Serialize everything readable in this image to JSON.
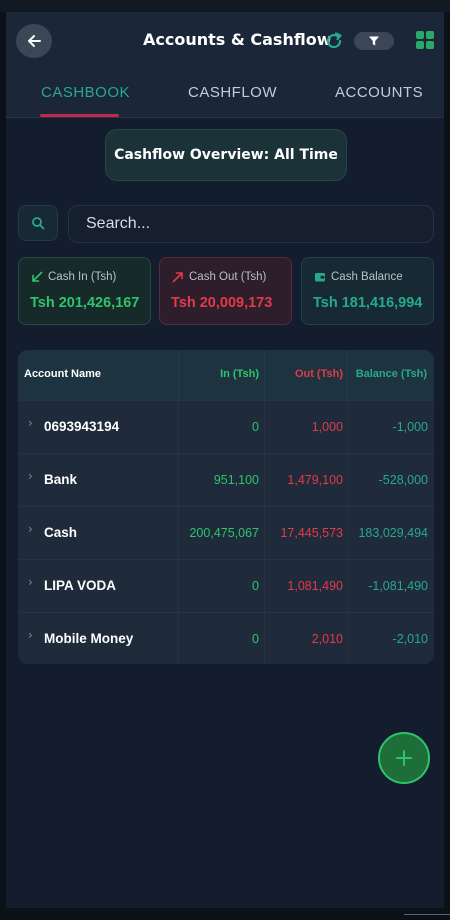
{
  "header": {
    "title": "Accounts & Cashflow",
    "back_icon": "arrow-left-icon",
    "refresh_icon": "refresh-icon",
    "filter_icon": "filter-icon",
    "grid_icon": "grid-icon"
  },
  "tabs": [
    {
      "label": "CASHBOOK",
      "active": true
    },
    {
      "label": "CASHFLOW",
      "active": false
    },
    {
      "label": "ACCOUNTS",
      "active": false
    }
  ],
  "overview": {
    "label": "Cashflow Overview: All Time"
  },
  "search": {
    "placeholder": "Search...",
    "value": ""
  },
  "summary": {
    "cash_in": {
      "label": "Cash In (Tsh)",
      "value": "Tsh 201,426,167"
    },
    "cash_out": {
      "label": "Cash Out (Tsh)",
      "value": "Tsh 20,009,173"
    },
    "cash_balance": {
      "label": "Cash Balance",
      "value": "Tsh 181,416,994"
    }
  },
  "table": {
    "headers": {
      "name": "Account Name",
      "in": "In (Tsh)",
      "out": "Out (Tsh)",
      "balance": "Balance (Tsh)"
    },
    "rows": [
      {
        "name": "0693943194",
        "in": "0",
        "out": "1,000",
        "balance": "-1,000"
      },
      {
        "name": "Bank",
        "in": "951,100",
        "out": "1,479,100",
        "balance": "-528,000"
      },
      {
        "name": "Cash",
        "in": "200,475,067",
        "out": "17,445,573",
        "balance": "183,029,494"
      },
      {
        "name": "LIPA VODA",
        "in": "0",
        "out": "1,081,490",
        "balance": "-1,081,490"
      },
      {
        "name": "Mobile Money",
        "in": "0",
        "out": "2,010",
        "balance": "-2,010"
      }
    ]
  },
  "colors": {
    "accent_teal": "#27a98c",
    "in_green": "#2ec46b",
    "out_red": "#e23a4a",
    "tab_underline": "#c0294a"
  }
}
